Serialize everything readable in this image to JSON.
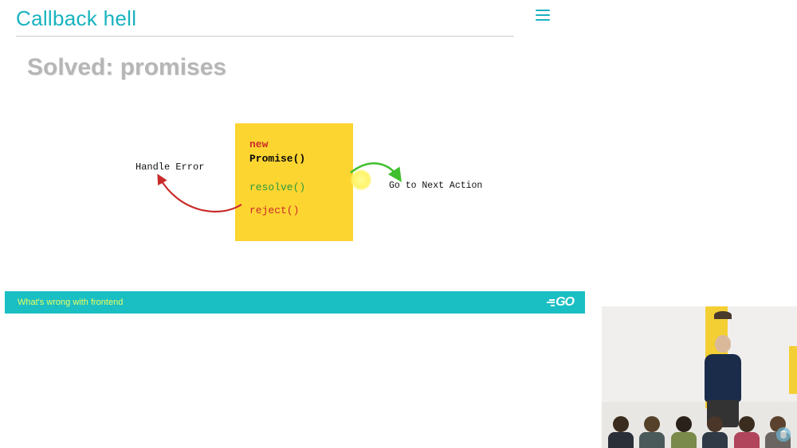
{
  "header": {
    "title": "Callback hell"
  },
  "subtitle": "Solved: promises",
  "diagram": {
    "new_kw": "new",
    "promise_kw": "Promise",
    "parens": "()",
    "resolve": "resolve()",
    "reject": "reject()",
    "handle_error": "Handle Error",
    "next_action": "Go to Next Action"
  },
  "footer": {
    "caption": "What's wrong with frontend",
    "logo_text": "GO"
  },
  "colors": {
    "accent": "#18b3bf",
    "footer_bg": "#1abfc4",
    "footer_text": "#e8ff62",
    "promise_box": "#fdd531"
  },
  "audience": [
    {
      "hair": "#3a2c1e",
      "shirt": "#2b2f38"
    },
    {
      "hair": "#55402a",
      "shirt": "#4a5a5a"
    },
    {
      "hair": "#2a211a",
      "shirt": "#7a8a4a"
    },
    {
      "hair": "#4a372a",
      "shirt": "#2f3a46"
    },
    {
      "hair": "#3a2c1e",
      "shirt": "#b0455c"
    },
    {
      "hair": "#5a422e",
      "shirt": "#6a6560"
    }
  ]
}
